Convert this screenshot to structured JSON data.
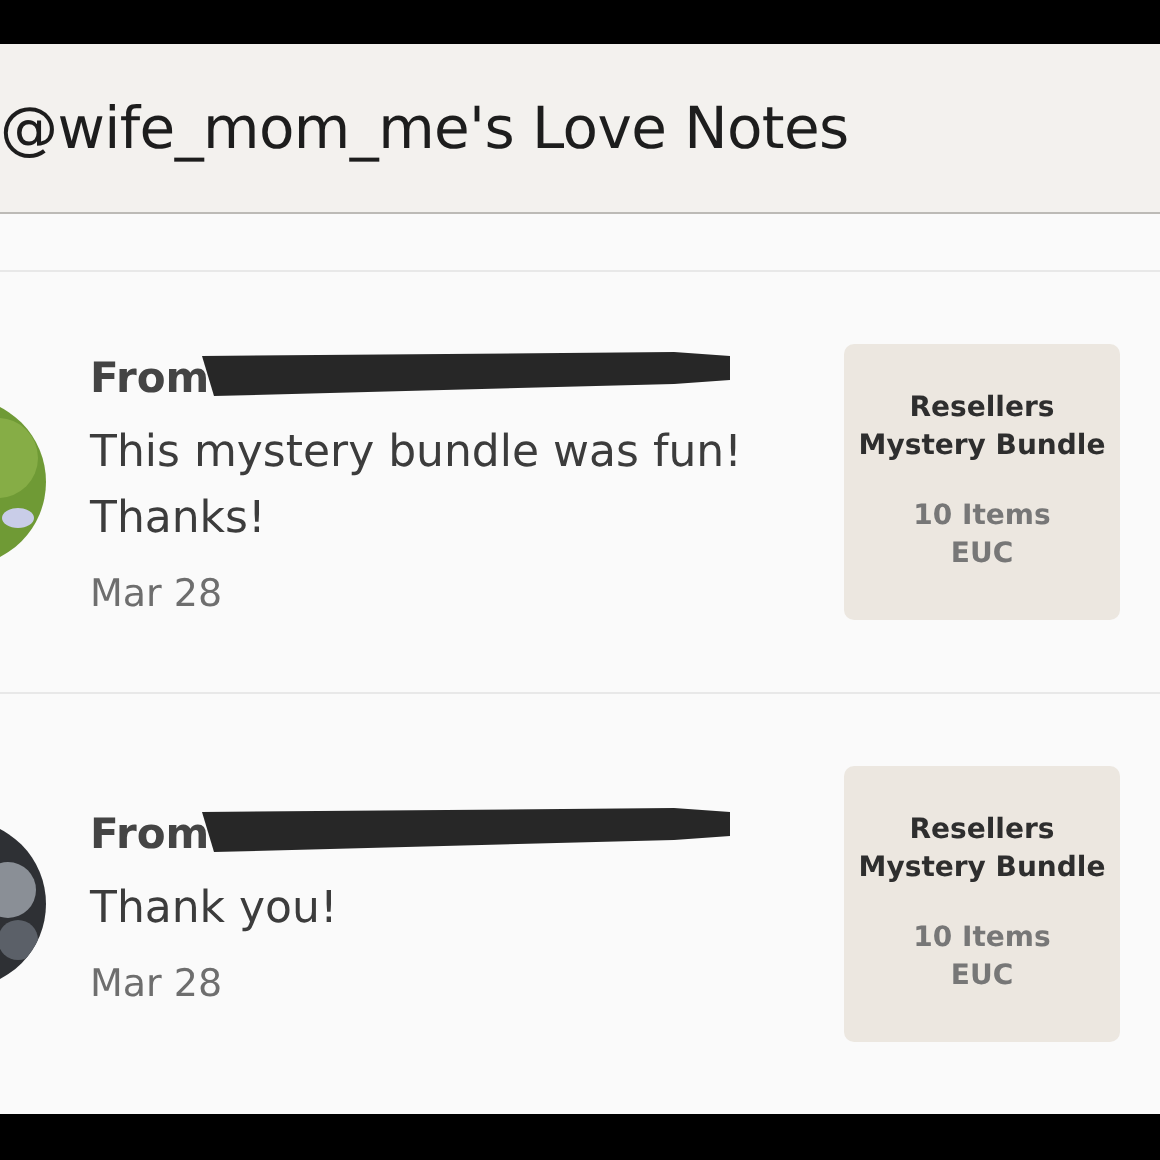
{
  "header": {
    "title": "@wife_mom_me's Love Notes"
  },
  "notes": [
    {
      "from": "From",
      "message": "This mystery bundle was fun! Thanks!",
      "date": "Mar 28",
      "product": {
        "title": "Resellers Mystery Bundle",
        "subtitle": "10 Items EUC"
      }
    },
    {
      "from": "From",
      "message": "Thank you!",
      "date": "Mar 28",
      "product": {
        "title": "Resellers Mystery Bundle",
        "subtitle": "10 Items EUC"
      }
    }
  ]
}
